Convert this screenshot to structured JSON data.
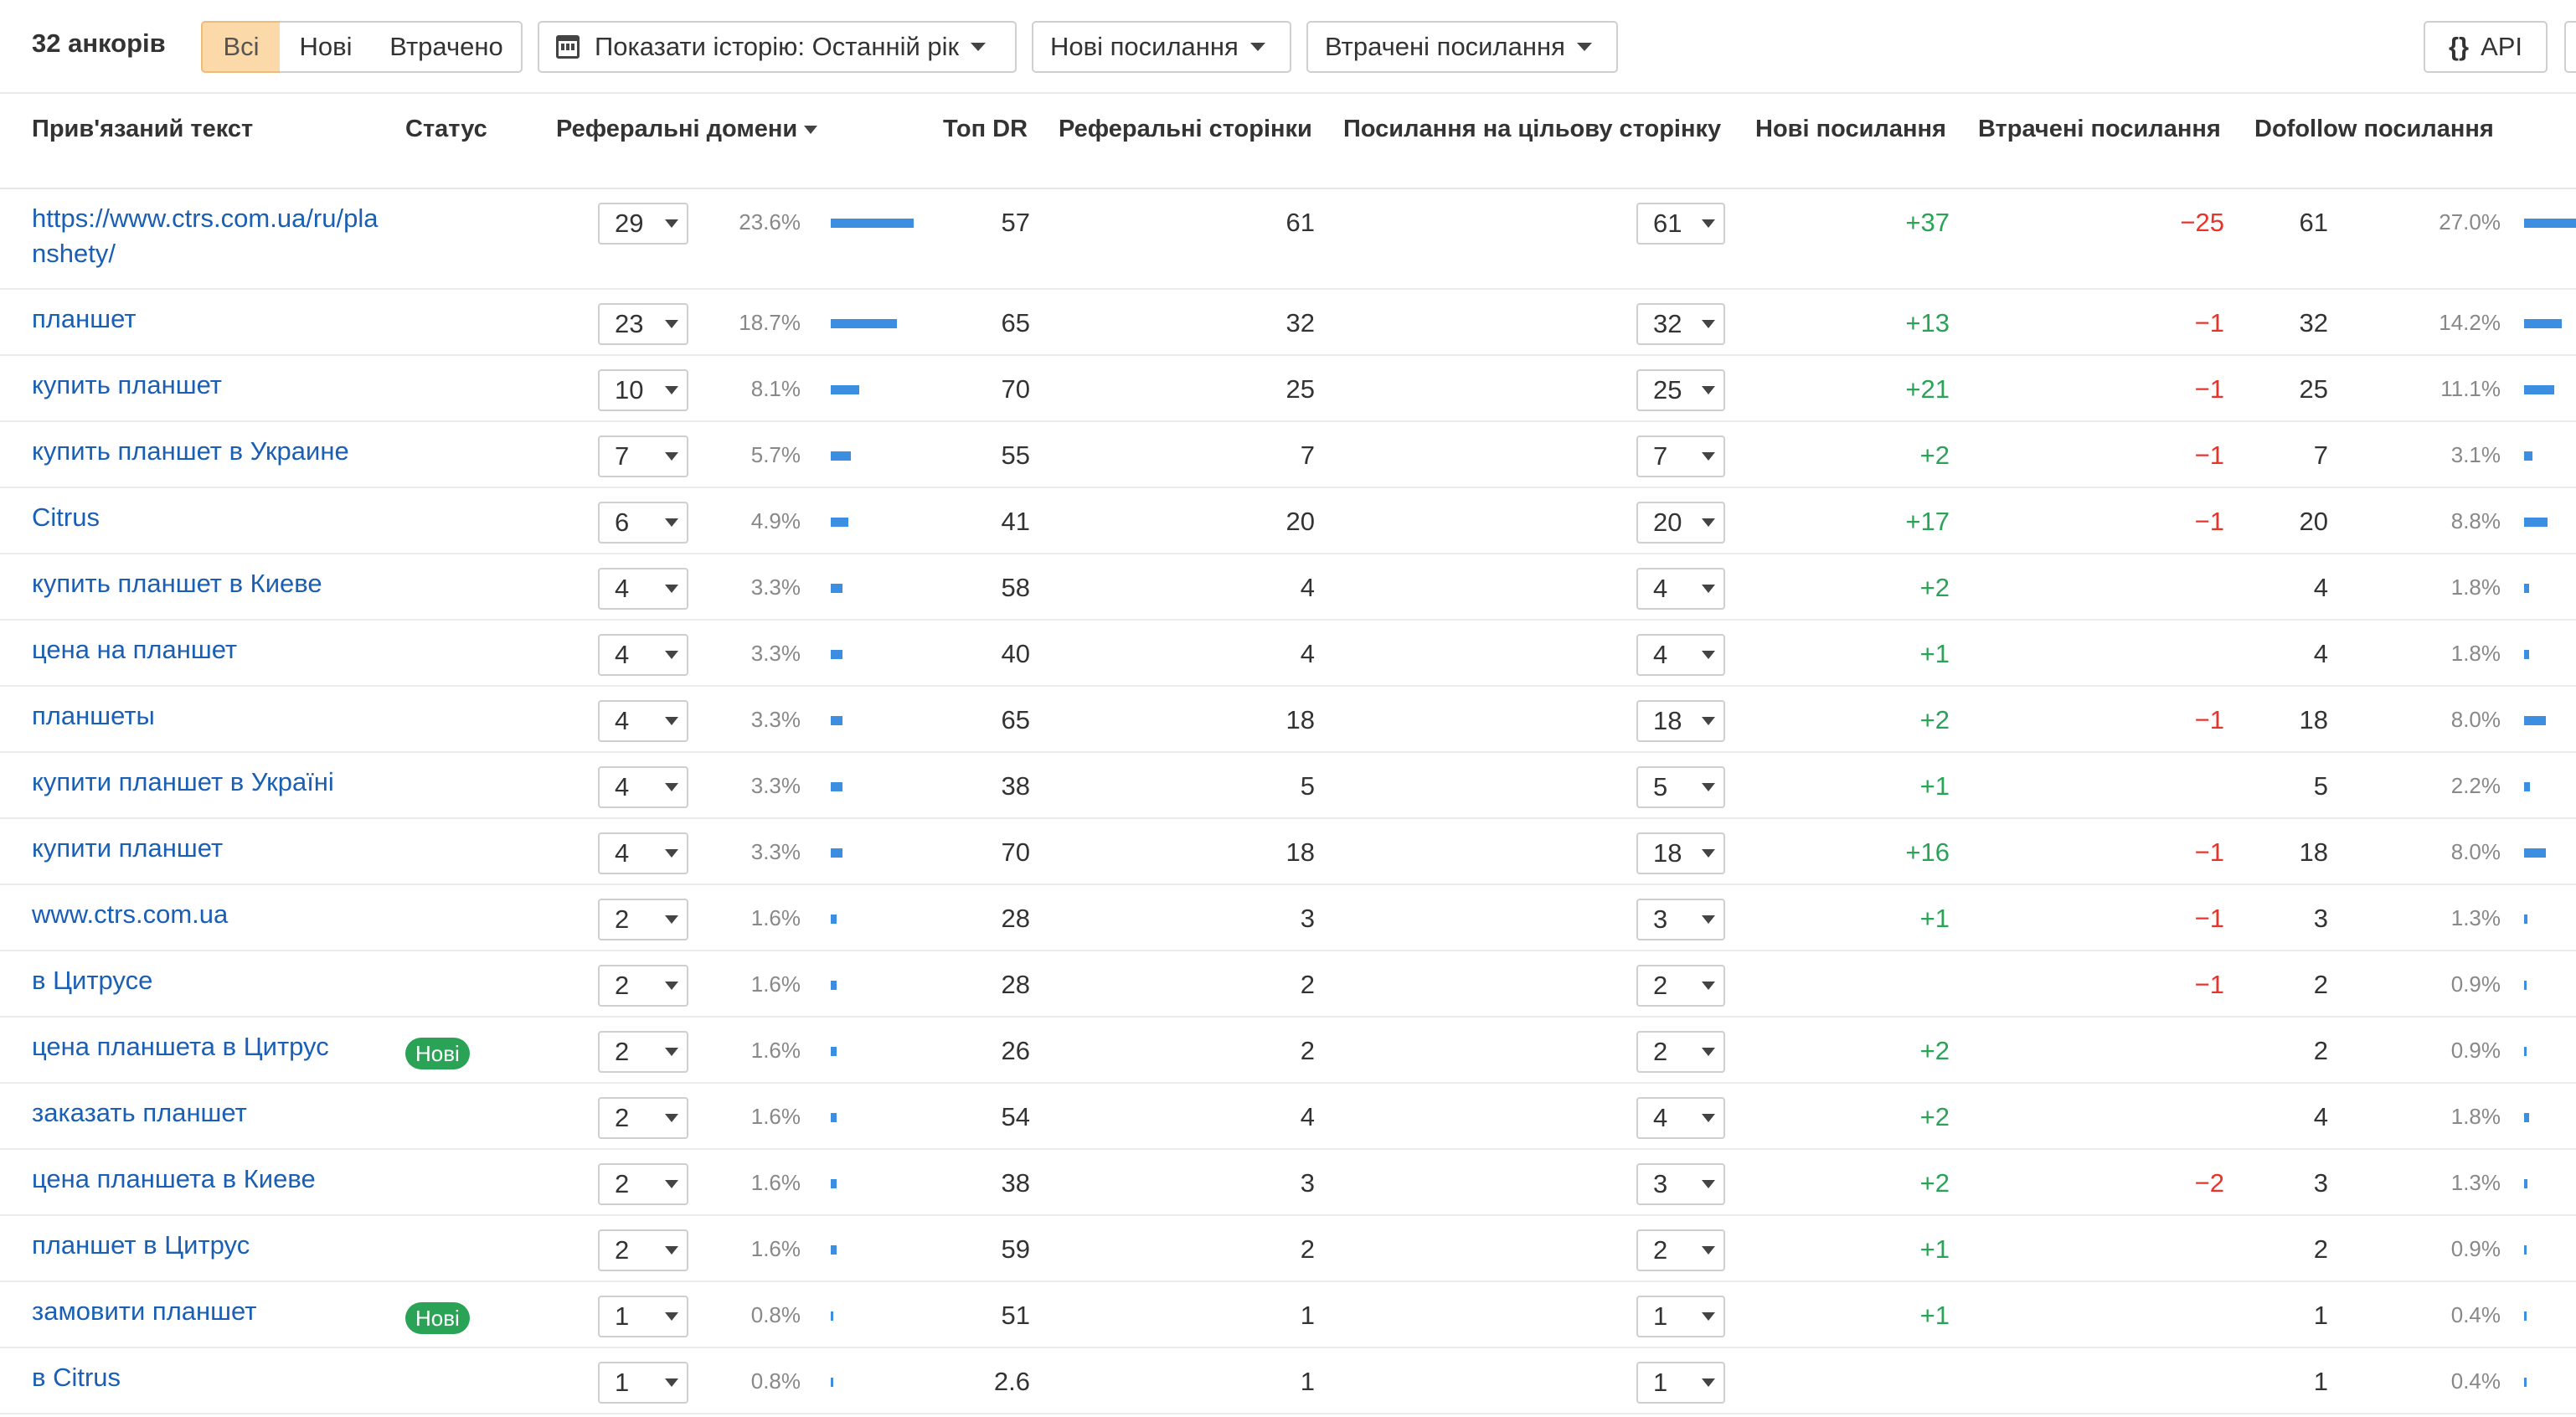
{
  "toolbar": {
    "count_label": "32 анкорів",
    "filter_all": "Всі",
    "filter_new": "Нові",
    "filter_lost": "Втрачено",
    "history_label": "Показати історію: Останній рік",
    "new_links_label": "Нові посилання",
    "lost_links_label": "Втрачені посилання",
    "api_icon": "{}",
    "api_label": "API"
  },
  "columns": {
    "anchor": "Прив'язаний текст",
    "status": "Статус",
    "ref_domains": "Реферальні домени",
    "top_dr": "Топ DR",
    "ref_pages": "Реферальні сторінки",
    "target_links": "Посилання на цільову сторінку",
    "new_links": "Нові посилання",
    "lost_links": "Втрачені посилання",
    "dofollow": "Dofollow посилання"
  },
  "colors": {
    "link": "#1a5fb4",
    "positive": "#2aa356",
    "negative": "#e8332a",
    "bar": "#3b8ee0",
    "active_filter": "#fcd9a8",
    "badge": "#2aa356"
  },
  "rows": [
    {
      "anchor": "https://www.ctrs.com.ua/ru/planshety/",
      "status": "",
      "domains": "29",
      "domains_pct": "23.6%",
      "top_dr": "57",
      "ref_pages": "61",
      "target": "61",
      "new": "+37",
      "lost": "−25",
      "dofollow": "61",
      "dofollow_pct": "27.0%"
    },
    {
      "anchor": "планшет",
      "status": "",
      "domains": "23",
      "domains_pct": "18.7%",
      "top_dr": "65",
      "ref_pages": "32",
      "target": "32",
      "new": "+13",
      "lost": "−1",
      "dofollow": "32",
      "dofollow_pct": "14.2%"
    },
    {
      "anchor": "купить планшет",
      "status": "",
      "domains": "10",
      "domains_pct": "8.1%",
      "top_dr": "70",
      "ref_pages": "25",
      "target": "25",
      "new": "+21",
      "lost": "−1",
      "dofollow": "25",
      "dofollow_pct": "11.1%"
    },
    {
      "anchor": "купить планшет в Украине",
      "status": "",
      "domains": "7",
      "domains_pct": "5.7%",
      "top_dr": "55",
      "ref_pages": "7",
      "target": "7",
      "new": "+2",
      "lost": "−1",
      "dofollow": "7",
      "dofollow_pct": "3.1%"
    },
    {
      "anchor": "Citrus",
      "status": "",
      "domains": "6",
      "domains_pct": "4.9%",
      "top_dr": "41",
      "ref_pages": "20",
      "target": "20",
      "new": "+17",
      "lost": "−1",
      "dofollow": "20",
      "dofollow_pct": "8.8%"
    },
    {
      "anchor": "купить планшет в Киеве",
      "status": "",
      "domains": "4",
      "domains_pct": "3.3%",
      "top_dr": "58",
      "ref_pages": "4",
      "target": "4",
      "new": "+2",
      "lost": "",
      "dofollow": "4",
      "dofollow_pct": "1.8%"
    },
    {
      "anchor": "цена на планшет",
      "status": "",
      "domains": "4",
      "domains_pct": "3.3%",
      "top_dr": "40",
      "ref_pages": "4",
      "target": "4",
      "new": "+1",
      "lost": "",
      "dofollow": "4",
      "dofollow_pct": "1.8%"
    },
    {
      "anchor": "планшеты",
      "status": "",
      "domains": "4",
      "domains_pct": "3.3%",
      "top_dr": "65",
      "ref_pages": "18",
      "target": "18",
      "new": "+2",
      "lost": "−1",
      "dofollow": "18",
      "dofollow_pct": "8.0%"
    },
    {
      "anchor": "купити планшет в Україні",
      "status": "",
      "domains": "4",
      "domains_pct": "3.3%",
      "top_dr": "38",
      "ref_pages": "5",
      "target": "5",
      "new": "+1",
      "lost": "",
      "dofollow": "5",
      "dofollow_pct": "2.2%"
    },
    {
      "anchor": "купити планшет",
      "status": "",
      "domains": "4",
      "domains_pct": "3.3%",
      "top_dr": "70",
      "ref_pages": "18",
      "target": "18",
      "new": "+16",
      "lost": "−1",
      "dofollow": "18",
      "dofollow_pct": "8.0%"
    },
    {
      "anchor": "www.ctrs.com.ua",
      "status": "",
      "domains": "2",
      "domains_pct": "1.6%",
      "top_dr": "28",
      "ref_pages": "3",
      "target": "3",
      "new": "+1",
      "lost": "−1",
      "dofollow": "3",
      "dofollow_pct": "1.3%"
    },
    {
      "anchor": "в Цитрусе",
      "status": "",
      "domains": "2",
      "domains_pct": "1.6%",
      "top_dr": "28",
      "ref_pages": "2",
      "target": "2",
      "new": "",
      "lost": "−1",
      "dofollow": "2",
      "dofollow_pct": "0.9%"
    },
    {
      "anchor": "цена планшета в Цитрус",
      "status": "Нові",
      "domains": "2",
      "domains_pct": "1.6%",
      "top_dr": "26",
      "ref_pages": "2",
      "target": "2",
      "new": "+2",
      "lost": "",
      "dofollow": "2",
      "dofollow_pct": "0.9%"
    },
    {
      "anchor": "заказать планшет",
      "status": "",
      "domains": "2",
      "domains_pct": "1.6%",
      "top_dr": "54",
      "ref_pages": "4",
      "target": "4",
      "new": "+2",
      "lost": "",
      "dofollow": "4",
      "dofollow_pct": "1.8%"
    },
    {
      "anchor": "цена планшета в Киеве",
      "status": "",
      "domains": "2",
      "domains_pct": "1.6%",
      "top_dr": "38",
      "ref_pages": "3",
      "target": "3",
      "new": "+2",
      "lost": "−2",
      "dofollow": "3",
      "dofollow_pct": "1.3%"
    },
    {
      "anchor": "планшет в Цитрус",
      "status": "",
      "domains": "2",
      "domains_pct": "1.6%",
      "top_dr": "59",
      "ref_pages": "2",
      "target": "2",
      "new": "+1",
      "lost": "",
      "dofollow": "2",
      "dofollow_pct": "0.9%"
    },
    {
      "anchor": "замовити планшет",
      "status": "Нові",
      "domains": "1",
      "domains_pct": "0.8%",
      "top_dr": "51",
      "ref_pages": "1",
      "target": "1",
      "new": "+1",
      "lost": "",
      "dofollow": "1",
      "dofollow_pct": "0.4%"
    },
    {
      "anchor": "в Citrus",
      "status": "",
      "domains": "1",
      "domains_pct": "0.8%",
      "top_dr": "2.6",
      "ref_pages": "1",
      "target": "1",
      "new": "",
      "lost": "",
      "dofollow": "1",
      "dofollow_pct": "0.4%"
    }
  ]
}
